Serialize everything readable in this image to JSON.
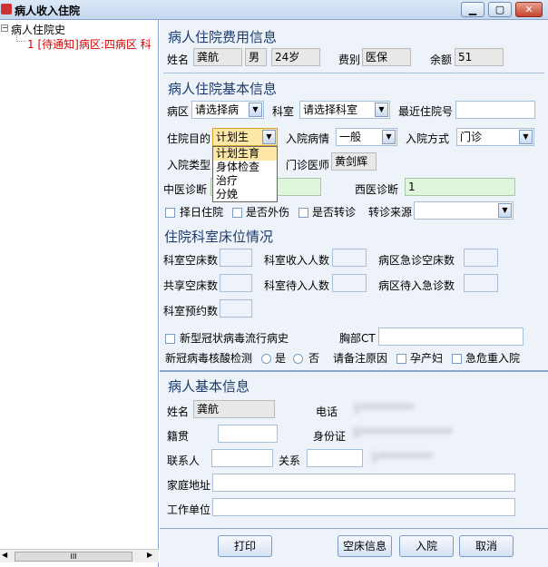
{
  "window": {
    "title": "病人收入住院"
  },
  "tree": {
    "root": "病人住院史",
    "child": "1 [待通知]病区:四病区 科"
  },
  "fee": {
    "title": "病人住院费用信息",
    "name_label": "姓名",
    "name": "龚航",
    "sex": "男",
    "age": "24岁",
    "feetype_label": "费别",
    "feetype": "医保",
    "balance_label": "余额",
    "balance": "51"
  },
  "basic": {
    "title": "病人住院基本信息",
    "ward_label": "病区",
    "ward": "请选择病",
    "dept_label": "科室",
    "dept": "请选择科室",
    "recent_label": "最近住院号",
    "recent": "",
    "purpose_label": "住院目的",
    "purpose": "计划生",
    "condition_label": "入院病情",
    "condition": "一般",
    "way_label": "入院方式",
    "way": "门诊",
    "type_label": "入院类型",
    "doctor_label": "门诊医师",
    "doctor": "黄剑辉",
    "tcm_label": "中医诊断",
    "tcm": "",
    "wm_label": "西医诊断",
    "wm": "1",
    "chk_date": "择日住院",
    "chk_injury": "是否外伤",
    "chk_transfer": "是否转诊",
    "source_label": "转诊来源",
    "source": ""
  },
  "purpose_options": [
    "计划生育",
    "身体检查",
    "治疗",
    "分娩"
  ],
  "beds": {
    "title": "住院科室床位情况",
    "l1": "科室空床数",
    "l2": "科室收入人数",
    "l3": "病区急诊空床数",
    "l4": "共享空床数",
    "l5": "科室待入人数",
    "l6": "病区待入急诊数",
    "l7": "科室预约数"
  },
  "covid": {
    "history": "新型冠状病毒流行病史",
    "ct_label": "胸部CT",
    "ct": "",
    "test_label": "新冠病毒核酸检测",
    "yes": "是",
    "no": "否",
    "note_label": "请备注原因",
    "pregnant": "孕产妇",
    "critical": "急危重入院"
  },
  "patient": {
    "title": "病人基本信息",
    "name_label": "姓名",
    "name": "龚航",
    "phone_label": "电话",
    "phone": "1**********",
    "native_label": "籍贯",
    "native": "",
    "id_label": "身份证",
    "id": "5*****************",
    "contact_label": "联系人",
    "contact": "",
    "relation_label": "关系",
    "relation": "",
    "relation_extra": "1**********",
    "address_label": "家庭地址",
    "address": "",
    "work_label": "工作单位",
    "work": ""
  },
  "buttons": {
    "print": "打印",
    "empty_bed": "空床信息",
    "admit": "入院",
    "cancel": "取消"
  },
  "scroll_thumb": "III"
}
